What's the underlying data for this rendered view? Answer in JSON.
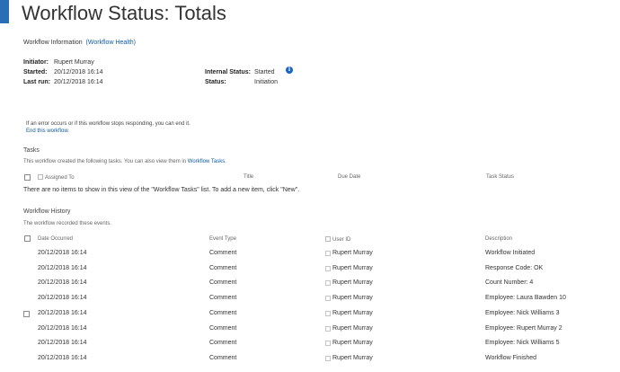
{
  "page": {
    "title": "Workflow Status: Totals"
  },
  "workflow_info": {
    "label": "Workflow Information",
    "health_link": "(Workflow Health)",
    "initiator_label": "Initiator:",
    "initiator_value": "Rupert Murray",
    "started_label": "Started:",
    "started_value": "20/12/2018 16:14",
    "last_run_label": "Last run:",
    "last_run_value": "20/12/2018 16:14",
    "internal_status_label": "Internal Status:",
    "internal_status_value": "Started",
    "status_label": "Status:",
    "status_value": "Initiation"
  },
  "end_workflow": {
    "note": "If an error occurs or if this workflow stops responding, you can end it.",
    "link": "End this workflow."
  },
  "tasks": {
    "title": "Tasks",
    "description_prefix": "This workflow created the following tasks. You can also view them in ",
    "description_link": "Workflow Tasks",
    "description_suffix": ".",
    "columns": [
      "Assigned To",
      "Title",
      "Due Date",
      "Task Status"
    ],
    "empty_message": "There are no items to show in this view of the \"Workflow Tasks\" list. To add a new item, click \"New\"."
  },
  "history": {
    "title": "Workflow History",
    "description": "The workflow recorded these events.",
    "columns": [
      "Date Occurred",
      "Event Type",
      "User ID",
      "Description"
    ],
    "rows": [
      {
        "date": "20/12/2018 16:14",
        "event": "Comment",
        "user": "Rupert Murray",
        "desc": "Workflow Initiated"
      },
      {
        "date": "20/12/2018 16:14",
        "event": "Comment",
        "user": "Rupert Murray",
        "desc": "Response Code: OK"
      },
      {
        "date": "20/12/2018 16:14",
        "event": "Comment",
        "user": "Rupert Murray",
        "desc": "Count Number: 4"
      },
      {
        "date": "20/12/2018 16:14",
        "event": "Comment",
        "user": "Rupert Murray",
        "desc": "Employee:  Laura Bawden 10"
      },
      {
        "date": "20/12/2018 16:14",
        "event": "Comment",
        "user": "Rupert Murray",
        "desc": "Employee:  Nick Williams 3"
      },
      {
        "date": "20/12/2018 16:14",
        "event": "Comment",
        "user": "Rupert Murray",
        "desc": "Employee:  Rupert Murray 2"
      },
      {
        "date": "20/12/2018 16:14",
        "event": "Comment",
        "user": "Rupert Murray",
        "desc": "Employee:  Nick Williams 5"
      },
      {
        "date": "20/12/2018 16:14",
        "event": "Comment",
        "user": "Rupert Murray",
        "desc": "Workflow Finished"
      }
    ]
  }
}
